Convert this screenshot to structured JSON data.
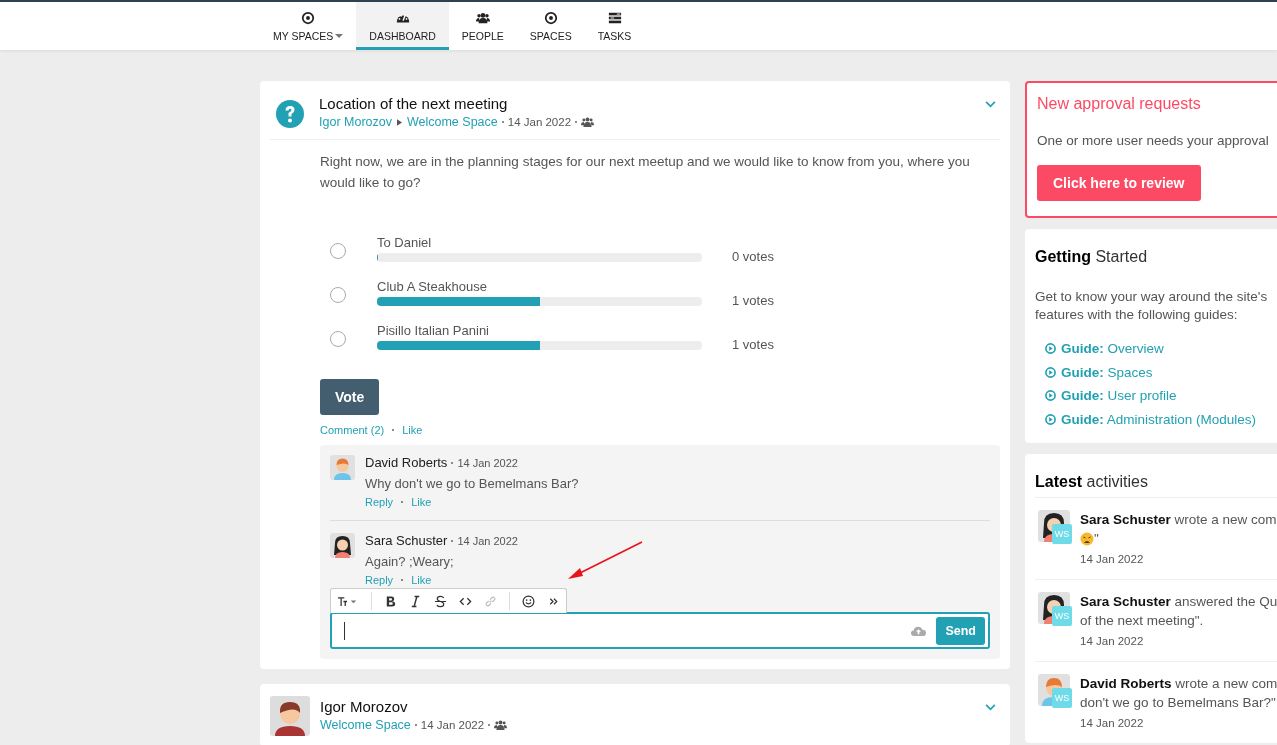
{
  "nav": {
    "items": [
      {
        "label": "MY SPACES",
        "dropdown": true,
        "selected": false
      },
      {
        "label": "DASHBOARD",
        "dropdown": false,
        "selected": true
      },
      {
        "label": "PEOPLE",
        "dropdown": false,
        "selected": false
      },
      {
        "label": "SPACES",
        "dropdown": false,
        "selected": false
      },
      {
        "label": "TASKS",
        "dropdown": false,
        "selected": false
      }
    ]
  },
  "post": {
    "title": "Location of the next meeting",
    "author": "Igor Morozov",
    "space": "Welcome Space",
    "date": "14 Jan 2022",
    "body": "Right now, we are in the planning stages for our next meetup and we would like to know from you, where you would like to go?",
    "poll": [
      {
        "label": "To Daniel",
        "level": 0,
        "votes": "0 votes",
        "selected": false
      },
      {
        "label": "Club A Steakhouse",
        "level": 0.5,
        "votes": "1 votes",
        "selected": false
      },
      {
        "label": "Pisillo Italian Panini",
        "level": 0.5,
        "votes": "1 votes",
        "selected": false
      }
    ],
    "vote_button": "Vote",
    "comment_link": "Comment (2)",
    "like_link": "Like",
    "comments": [
      {
        "author": "David Roberts",
        "date": "14 Jan 2022",
        "text": "Why don't we go to Bemelmans Bar?",
        "reply": "Reply",
        "like": "Like"
      },
      {
        "author": "Sara Schuster",
        "date": "14 Jan 2022",
        "text": "Again? ;Weary;",
        "reply": "Reply",
        "like": "Like"
      }
    ],
    "send_button": "Send"
  },
  "approval": {
    "title": "New approval requests",
    "text": "One or more user needs your approval",
    "button": "Click here to review"
  },
  "getting_started": {
    "title_bold": "Getting",
    "title_rest": "Started",
    "intro": [
      "Get to know your way around the site's",
      "features with the following guides:"
    ],
    "guides": [
      {
        "prefix": "Guide:",
        "label": "Overview"
      },
      {
        "prefix": "Guide:",
        "label": "Spaces"
      },
      {
        "prefix": "Guide:",
        "label": "User profile"
      },
      {
        "prefix": "Guide:",
        "label": "Administration (Modules)"
      }
    ]
  },
  "activities": {
    "title_bold": "Latest",
    "title_rest": "activities",
    "items": [
      {
        "author": "Sara Schuster",
        "action": "wrote a new com",
        "line2": "\"",
        "emoji": true,
        "date": "14 Jan 2022",
        "badge": "WS"
      },
      {
        "author": "Sara Schuster",
        "action": "answered the Qu",
        "line2": "of the next meeting\".",
        "emoji": false,
        "date": "14 Jan 2022",
        "badge": "WS"
      },
      {
        "author": "David Roberts",
        "action": "wrote a new com",
        "line2": "don't we go to Bemelmans Bar?\"",
        "emoji": false,
        "date": "14 Jan 2022",
        "badge": "WS"
      }
    ]
  },
  "post2": {
    "author": "Igor Morozov",
    "space": "Welcome Space",
    "date": "14 Jan 2022"
  }
}
